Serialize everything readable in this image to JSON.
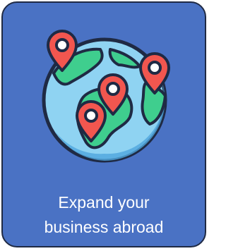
{
  "card": {
    "caption_line_1": "Expand your",
    "caption_line_2": "business abroad"
  },
  "icon": {
    "name": "globe-with-location-pins-icon",
    "colors": {
      "card_background": "#4a72c4",
      "globe_water": "#8fd3f2",
      "globe_shade": "#4fa6dd",
      "land": "#3fce8e",
      "pin": "#f2564f",
      "outline": "#1f2a44"
    }
  }
}
